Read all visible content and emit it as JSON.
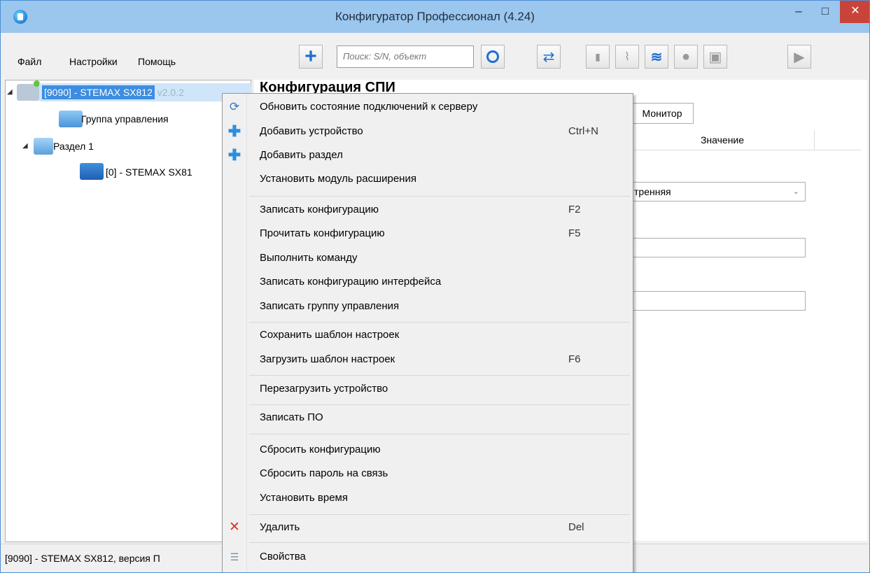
{
  "window": {
    "title": "Конфигуратор Профессионал (4.24)"
  },
  "menubar": {
    "file": "Файл",
    "settings": "Настройки",
    "help": "Помощь"
  },
  "toolbar": {
    "search_placeholder": "Поиск: S/N, объект"
  },
  "tree": {
    "root": "[9090] - STEMAX SX812",
    "root_version": "v2.0.2",
    "group": "Группа управления",
    "section": "Раздел 1",
    "device": "[0] - STEMAX SX81"
  },
  "main": {
    "title": "Конфигурация СПИ",
    "tab_monitor": "Монитор",
    "column_value": "Значение",
    "dropdown_value": "тренняя"
  },
  "statusbar": {
    "text": "[9090] - STEMAX SX812, версия П"
  },
  "context_menu": {
    "items": [
      {
        "label": "Обновить состояние подключений к серверу",
        "shortcut": "",
        "icon": "refresh-icon"
      },
      {
        "label": "Добавить устройство",
        "shortcut": "Ctrl+N",
        "icon": "add-device-icon"
      },
      {
        "label": "Добавить раздел",
        "shortcut": "",
        "icon": "add-section-icon"
      },
      {
        "label": "Установить модуль расширения",
        "shortcut": "",
        "icon": ""
      },
      {
        "label": "Записать конфигурацию",
        "shortcut": "F2",
        "icon": ""
      },
      {
        "label": "Прочитать конфигурацию",
        "shortcut": "F5",
        "icon": ""
      },
      {
        "label": "Выполнить команду",
        "shortcut": "",
        "icon": ""
      },
      {
        "label": "Записать конфигурацию интерфейса",
        "shortcut": "",
        "icon": ""
      },
      {
        "label": "Записать группу управления",
        "shortcut": "",
        "icon": ""
      },
      {
        "label": "Сохранить шаблон настроек",
        "shortcut": "",
        "icon": ""
      },
      {
        "label": "Загрузить шаблон настроек",
        "shortcut": "F6",
        "icon": ""
      },
      {
        "label": "Перезагрузить устройство",
        "shortcut": "",
        "icon": ""
      },
      {
        "label": "Записать ПО",
        "shortcut": "",
        "icon": ""
      },
      {
        "label": "Сбросить конфигурацию",
        "shortcut": "",
        "icon": ""
      },
      {
        "label": "Сбросить пароль на связь",
        "shortcut": "",
        "icon": ""
      },
      {
        "label": "Установить время",
        "shortcut": "",
        "icon": ""
      },
      {
        "label": "Удалить",
        "shortcut": "Del",
        "icon": "delete-icon"
      },
      {
        "label": "Свойства",
        "shortcut": "",
        "icon": "properties-icon"
      }
    ]
  }
}
